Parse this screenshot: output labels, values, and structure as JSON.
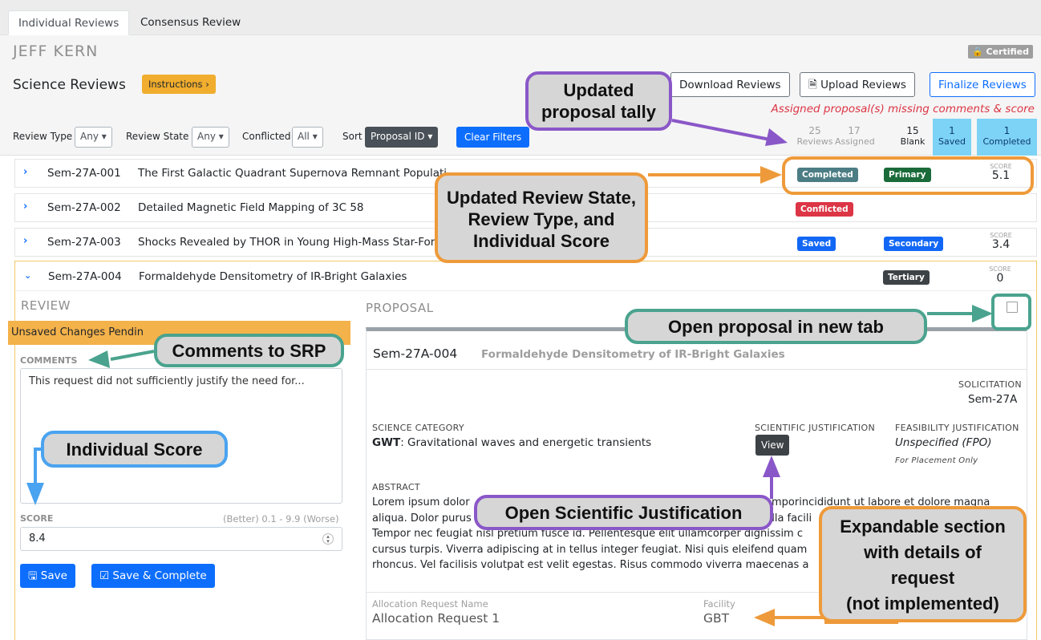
{
  "tabs": [
    {
      "label": "Individual Reviews"
    },
    {
      "label": "Consensus Review"
    }
  ],
  "user": {
    "name": "JEFF KERN",
    "certified": "🔒 Certified"
  },
  "header": {
    "title": "Science Reviews",
    "instructions": "Instructions ›",
    "download": "Download Reviews",
    "upload": "Upload Reviews",
    "finalize": "Finalize Reviews",
    "missing": "Assigned proposal(s) missing comments & score"
  },
  "filters": {
    "review_type_label": "Review Type",
    "review_type_value": "Any ▾",
    "review_state_label": "Review State",
    "review_state_value": "Any ▾",
    "conflicted_label": "Conflicted",
    "conflicted_value": "All ▾",
    "sort_label": "Sort",
    "sort_value": "Proposal ID ▾",
    "clear": "Clear Filters"
  },
  "tally": [
    {
      "num": "25",
      "label": "Reviews"
    },
    {
      "num": "17",
      "label": "Assigned"
    },
    {
      "num": "15",
      "label": "Blank"
    },
    {
      "num": "1",
      "label": "Saved"
    },
    {
      "num": "1",
      "label": "Completed"
    }
  ],
  "rows": [
    {
      "id": "Sem-27A-001",
      "title": "The First Galactic Quadrant Supernova Remnant Populati",
      "state": "Completed",
      "type": "Primary",
      "score_label": "SCORE",
      "score": "5.1"
    },
    {
      "id": "Sem-27A-002",
      "title": "Detailed Magnetic Field Mapping of 3C 58",
      "state": "Conflicted"
    },
    {
      "id": "Sem-27A-003",
      "title": "Shocks Revealed by THOR in Young High-Mass Star-For",
      "state": "Saved",
      "type": "Secondary",
      "score_label": "SCORE",
      "score": "3.4"
    },
    {
      "id": "Sem-27A-004",
      "title": "Formaldehyde Densitometry of IR-Bright Galaxies",
      "type": "Tertiary",
      "score_label": "SCORE",
      "score": "0"
    }
  ],
  "review": {
    "section": "REVIEW",
    "unsaved": "Unsaved Changes Pendin",
    "comments_label": "COMMENTS",
    "comments": "This request did not sufficiently justify the need for...",
    "score_label": "SCORE",
    "score_hint": "(Better) 0.1 - 9.9 (Worse)",
    "score_value": "8.4",
    "save": "Save",
    "save_complete": "Save & Complete"
  },
  "proposal": {
    "section": "PROPOSAL",
    "id": "Sem-27A-004",
    "title": "Formaldehyde Densitometry of IR-Bright Galaxies",
    "solicitation_label": "SOLICITATION",
    "solicitation": "Sem-27A",
    "science_category_label": "SCIENCE CATEGORY",
    "science_category_code": "GWT",
    "science_category_text": ": Gravitational waves and energetic transients",
    "sci_just_label": "SCIENTIFIC JUSTIFICATION",
    "view": "View",
    "feas_label": "FEASIBILITY JUSTIFICATION",
    "feas_value": "Unspecified (FPO)",
    "feas_note": "For Placement Only",
    "abstract_label": "ABSTRACT",
    "abstract_1": "Lorem ipsum dolor",
    "abstract_1b": "emporincididunt ut labore et dolore magna",
    "abstract_2": "aliqua. Dolor purus",
    "abstract_2b": "ulla facili",
    "abstract_3": "Tempor nec feugiat nisl pretium fusce id. Pellentesque elit ullamcorper dignissim c",
    "abstract_4": "cursus turpis. Viverra adipiscing at in tellus integer feugiat. Nisi quis eleifend quam",
    "abstract_5": "rhoncus. Vel facilisis volutpat est velit egestas. Risus commodo viverra maecenas a",
    "alloc_label": "Allocation Request Name",
    "alloc_value": "Allocation Request 1",
    "facility_label": "Facility",
    "facility_value": "GBT"
  },
  "callouts": {
    "tally": [
      "Updated",
      "proposal tally"
    ],
    "state": [
      "Updated Review State,",
      "Review Type, and",
      "Individual Score"
    ],
    "open_tab": "Open proposal in new tab",
    "comments": "Comments to SRP",
    "score": "Individual Score",
    "sci_just": "Open Scientific Justification",
    "expand": [
      "Expandable section",
      "with details of",
      "request",
      "(not implemented)"
    ]
  },
  "colors": {
    "purple": "#8a57c8",
    "orange": "#ee9a3a",
    "teal": "#4aa38e",
    "blue": "#4aa3f0"
  }
}
